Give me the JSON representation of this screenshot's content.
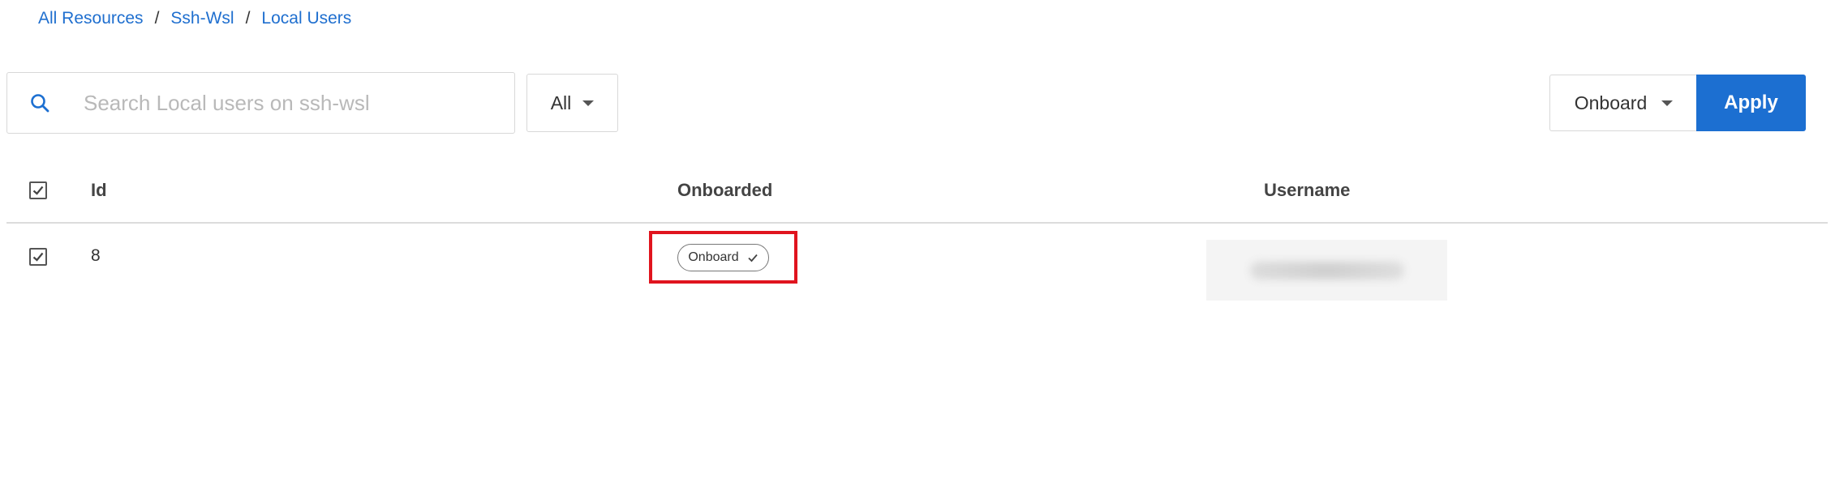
{
  "breadcrumb": {
    "items": [
      "All Resources",
      "Ssh-Wsl",
      "Local Users"
    ],
    "separator": "/"
  },
  "toolbar": {
    "search_placeholder": "Search Local users on ssh-wsl",
    "search_value": "",
    "filter_value": "All",
    "action_value": "Onboard",
    "apply_label": "Apply"
  },
  "table": {
    "headers": {
      "id": "Id",
      "onboarded": "Onboarded",
      "username": "Username"
    },
    "rows": [
      {
        "selected": true,
        "id": "8",
        "onboarded_label": "Onboard",
        "username": ""
      }
    ]
  },
  "colors": {
    "accent": "#1c6fd1",
    "link": "#1f6fcf",
    "highlight": "#e0141e"
  },
  "icons": {
    "search": "search-icon",
    "filter_caret": "chevron-down-icon",
    "action_caret": "chevron-down-icon",
    "checkbox": "check-icon",
    "status": "check-icon"
  }
}
